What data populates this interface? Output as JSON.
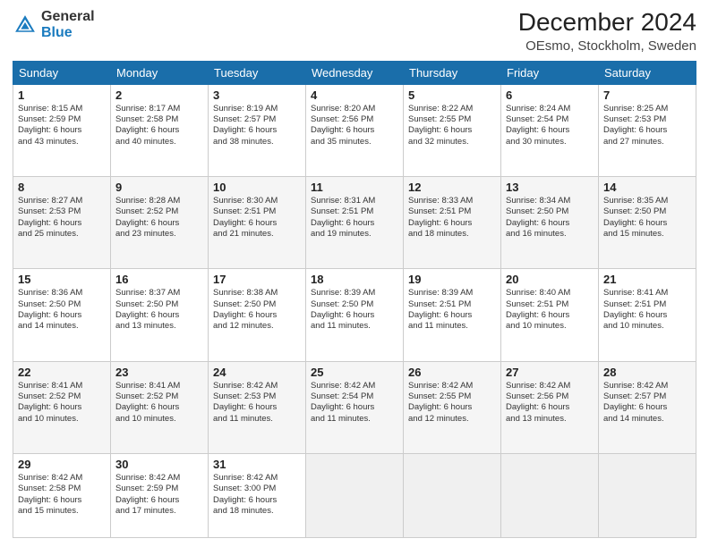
{
  "header": {
    "logo_general": "General",
    "logo_blue": "Blue",
    "title": "December 2024",
    "location": "OEsmo, Stockholm, Sweden"
  },
  "days_of_week": [
    "Sunday",
    "Monday",
    "Tuesday",
    "Wednesday",
    "Thursday",
    "Friday",
    "Saturday"
  ],
  "weeks": [
    [
      {
        "day": 1,
        "lines": [
          "Sunrise: 8:15 AM",
          "Sunset: 2:59 PM",
          "Daylight: 6 hours",
          "and 43 minutes."
        ]
      },
      {
        "day": 2,
        "lines": [
          "Sunrise: 8:17 AM",
          "Sunset: 2:58 PM",
          "Daylight: 6 hours",
          "and 40 minutes."
        ]
      },
      {
        "day": 3,
        "lines": [
          "Sunrise: 8:19 AM",
          "Sunset: 2:57 PM",
          "Daylight: 6 hours",
          "and 38 minutes."
        ]
      },
      {
        "day": 4,
        "lines": [
          "Sunrise: 8:20 AM",
          "Sunset: 2:56 PM",
          "Daylight: 6 hours",
          "and 35 minutes."
        ]
      },
      {
        "day": 5,
        "lines": [
          "Sunrise: 8:22 AM",
          "Sunset: 2:55 PM",
          "Daylight: 6 hours",
          "and 32 minutes."
        ]
      },
      {
        "day": 6,
        "lines": [
          "Sunrise: 8:24 AM",
          "Sunset: 2:54 PM",
          "Daylight: 6 hours",
          "and 30 minutes."
        ]
      },
      {
        "day": 7,
        "lines": [
          "Sunrise: 8:25 AM",
          "Sunset: 2:53 PM",
          "Daylight: 6 hours",
          "and 27 minutes."
        ]
      }
    ],
    [
      {
        "day": 8,
        "lines": [
          "Sunrise: 8:27 AM",
          "Sunset: 2:53 PM",
          "Daylight: 6 hours",
          "and 25 minutes."
        ]
      },
      {
        "day": 9,
        "lines": [
          "Sunrise: 8:28 AM",
          "Sunset: 2:52 PM",
          "Daylight: 6 hours",
          "and 23 minutes."
        ]
      },
      {
        "day": 10,
        "lines": [
          "Sunrise: 8:30 AM",
          "Sunset: 2:51 PM",
          "Daylight: 6 hours",
          "and 21 minutes."
        ]
      },
      {
        "day": 11,
        "lines": [
          "Sunrise: 8:31 AM",
          "Sunset: 2:51 PM",
          "Daylight: 6 hours",
          "and 19 minutes."
        ]
      },
      {
        "day": 12,
        "lines": [
          "Sunrise: 8:33 AM",
          "Sunset: 2:51 PM",
          "Daylight: 6 hours",
          "and 18 minutes."
        ]
      },
      {
        "day": 13,
        "lines": [
          "Sunrise: 8:34 AM",
          "Sunset: 2:50 PM",
          "Daylight: 6 hours",
          "and 16 minutes."
        ]
      },
      {
        "day": 14,
        "lines": [
          "Sunrise: 8:35 AM",
          "Sunset: 2:50 PM",
          "Daylight: 6 hours",
          "and 15 minutes."
        ]
      }
    ],
    [
      {
        "day": 15,
        "lines": [
          "Sunrise: 8:36 AM",
          "Sunset: 2:50 PM",
          "Daylight: 6 hours",
          "and 14 minutes."
        ]
      },
      {
        "day": 16,
        "lines": [
          "Sunrise: 8:37 AM",
          "Sunset: 2:50 PM",
          "Daylight: 6 hours",
          "and 13 minutes."
        ]
      },
      {
        "day": 17,
        "lines": [
          "Sunrise: 8:38 AM",
          "Sunset: 2:50 PM",
          "Daylight: 6 hours",
          "and 12 minutes."
        ]
      },
      {
        "day": 18,
        "lines": [
          "Sunrise: 8:39 AM",
          "Sunset: 2:50 PM",
          "Daylight: 6 hours",
          "and 11 minutes."
        ]
      },
      {
        "day": 19,
        "lines": [
          "Sunrise: 8:39 AM",
          "Sunset: 2:51 PM",
          "Daylight: 6 hours",
          "and 11 minutes."
        ]
      },
      {
        "day": 20,
        "lines": [
          "Sunrise: 8:40 AM",
          "Sunset: 2:51 PM",
          "Daylight: 6 hours",
          "and 10 minutes."
        ]
      },
      {
        "day": 21,
        "lines": [
          "Sunrise: 8:41 AM",
          "Sunset: 2:51 PM",
          "Daylight: 6 hours",
          "and 10 minutes."
        ]
      }
    ],
    [
      {
        "day": 22,
        "lines": [
          "Sunrise: 8:41 AM",
          "Sunset: 2:52 PM",
          "Daylight: 6 hours",
          "and 10 minutes."
        ]
      },
      {
        "day": 23,
        "lines": [
          "Sunrise: 8:41 AM",
          "Sunset: 2:52 PM",
          "Daylight: 6 hours",
          "and 10 minutes."
        ]
      },
      {
        "day": 24,
        "lines": [
          "Sunrise: 8:42 AM",
          "Sunset: 2:53 PM",
          "Daylight: 6 hours",
          "and 11 minutes."
        ]
      },
      {
        "day": 25,
        "lines": [
          "Sunrise: 8:42 AM",
          "Sunset: 2:54 PM",
          "Daylight: 6 hours",
          "and 11 minutes."
        ]
      },
      {
        "day": 26,
        "lines": [
          "Sunrise: 8:42 AM",
          "Sunset: 2:55 PM",
          "Daylight: 6 hours",
          "and 12 minutes."
        ]
      },
      {
        "day": 27,
        "lines": [
          "Sunrise: 8:42 AM",
          "Sunset: 2:56 PM",
          "Daylight: 6 hours",
          "and 13 minutes."
        ]
      },
      {
        "day": 28,
        "lines": [
          "Sunrise: 8:42 AM",
          "Sunset: 2:57 PM",
          "Daylight: 6 hours",
          "and 14 minutes."
        ]
      }
    ],
    [
      {
        "day": 29,
        "lines": [
          "Sunrise: 8:42 AM",
          "Sunset: 2:58 PM",
          "Daylight: 6 hours",
          "and 15 minutes."
        ]
      },
      {
        "day": 30,
        "lines": [
          "Sunrise: 8:42 AM",
          "Sunset: 2:59 PM",
          "Daylight: 6 hours",
          "and 17 minutes."
        ]
      },
      {
        "day": 31,
        "lines": [
          "Sunrise: 8:42 AM",
          "Sunset: 3:00 PM",
          "Daylight: 6 hours",
          "and 18 minutes."
        ]
      },
      null,
      null,
      null,
      null
    ]
  ]
}
